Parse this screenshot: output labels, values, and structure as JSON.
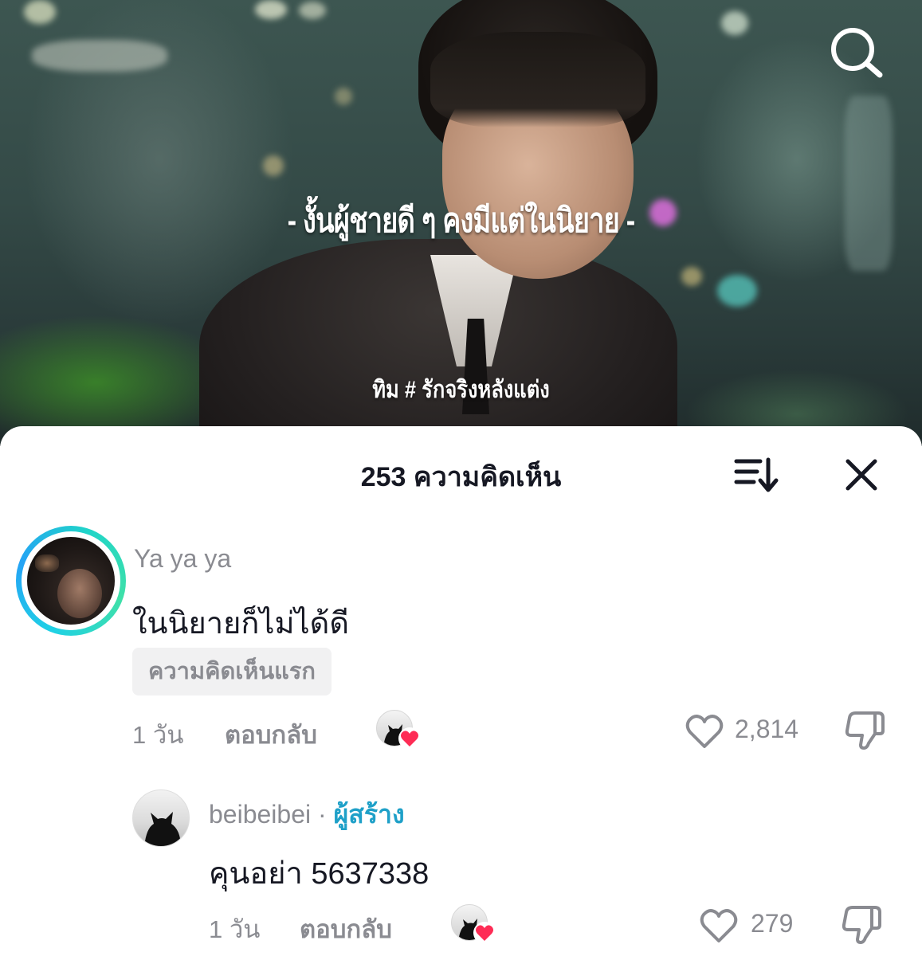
{
  "video": {
    "subtitle": "- งั้นผู้ชายดี ๆ คงมีแต่ในนิยาย -",
    "credit": "ทิม # รักจริงหลังแต่ง",
    "search_icon": "search-icon"
  },
  "comments_panel": {
    "title": "253 ความคิดเห็น",
    "sort_icon": "sort-icon",
    "close_icon": "close-icon"
  },
  "comments": [
    {
      "username": "Ya ya ya",
      "text": "ในนิยายก็ไม่ได้ดี",
      "badge": "ความคิดเห็นแรก",
      "time": "1 วัน",
      "reply_label": "ตอบกลับ",
      "likes": "2,814",
      "story_ring_color": "#1fd1e5"
    },
    {
      "username": "beibeibei",
      "separator": "·",
      "creator_tag": "ผู้สร้าง",
      "text": "คุนอย่า 5637338",
      "time": "1 วัน",
      "reply_label": "ตอบกลับ",
      "likes": "279"
    }
  ],
  "colors": {
    "accent_heart": "#fe2c55",
    "creator_tag": "#1ea0c8",
    "muted_text": "#8a8b91",
    "primary_text": "#161823"
  }
}
